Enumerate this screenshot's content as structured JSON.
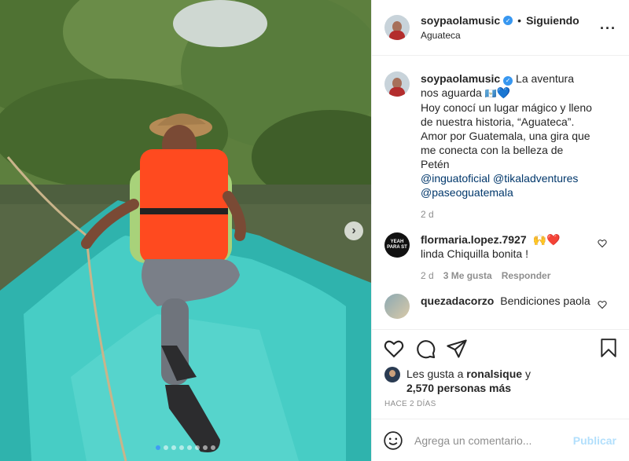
{
  "post": {
    "username": "soypaolamusic",
    "follow_status": "Siguiendo",
    "location": "Aguateca",
    "more_icon": "more-horizontal-icon",
    "carousel": {
      "total": 8,
      "active_index": 0
    }
  },
  "caption": {
    "username": "soypaolamusic",
    "text_start": "La aventura nos aguarda",
    "flag_emoji": "🇬🇹",
    "heart_emoji": "💙",
    "text_body": "Hoy conocí un lugar mágico y lleno de nuestra historia, “Aguateca”. Amor por Guatemala, una gira que me conecta con la belleza de Petén",
    "mentions": [
      "@inguatoficial",
      "@tikaladventures",
      "@paseoguatemala"
    ],
    "age": "2 d"
  },
  "comments": [
    {
      "username": "flormaria.lopez.7927",
      "emoji": "🙌❤️",
      "text": "linda Chiquilla bonita !",
      "age": "2 d",
      "likes": "3 Me gusta",
      "reply": "Responder",
      "avatar_text": "YEAH PARA ST"
    },
    {
      "username": "quezadacorzo",
      "text": "Bendiciones paola"
    }
  ],
  "likes": {
    "prefix": "Les gusta a",
    "user": "ronalsique",
    "conj": "y",
    "others": "2,570 personas más"
  },
  "timestamp": "HACE 2 DÍAS",
  "add_comment": {
    "placeholder": "Agrega un comentario...",
    "publish": "Publicar"
  },
  "colors": {
    "verified": "#3897f0",
    "link": "#00376b",
    "publish_disabled": "#b2dffc",
    "boat": "#3ec8c0",
    "life_vest": "#ff4a1f"
  }
}
